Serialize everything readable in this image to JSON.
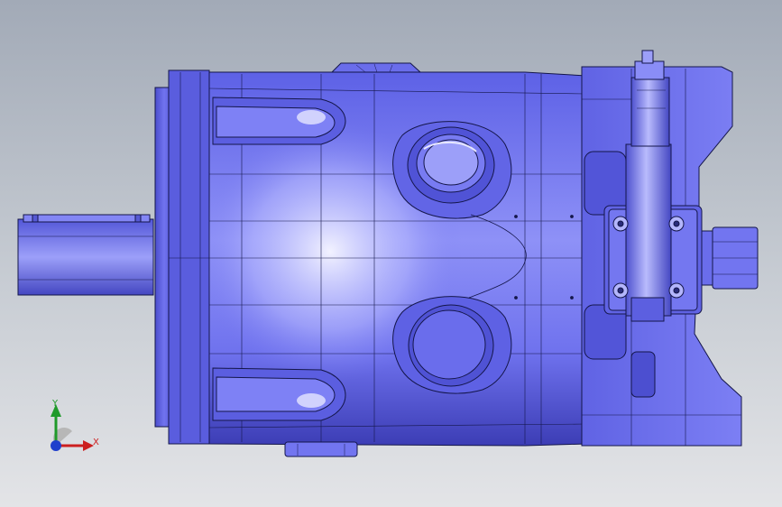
{
  "viewport": {
    "background_top": "#a2aab7",
    "background_bottom": "#e3e4e7",
    "model_fill": "#6c6ff0",
    "model_fill_dark": "#3e3fb8",
    "model_highlight": "#dcdcff",
    "edge_color": "#14164a"
  },
  "model": {
    "icon": "hydraulic-pump-model"
  },
  "triad": {
    "x_label": "X",
    "y_label": "Y",
    "x_color": "#cc1f1f",
    "y_color": "#1f9a2a",
    "z_color": "#1f3fcc"
  }
}
